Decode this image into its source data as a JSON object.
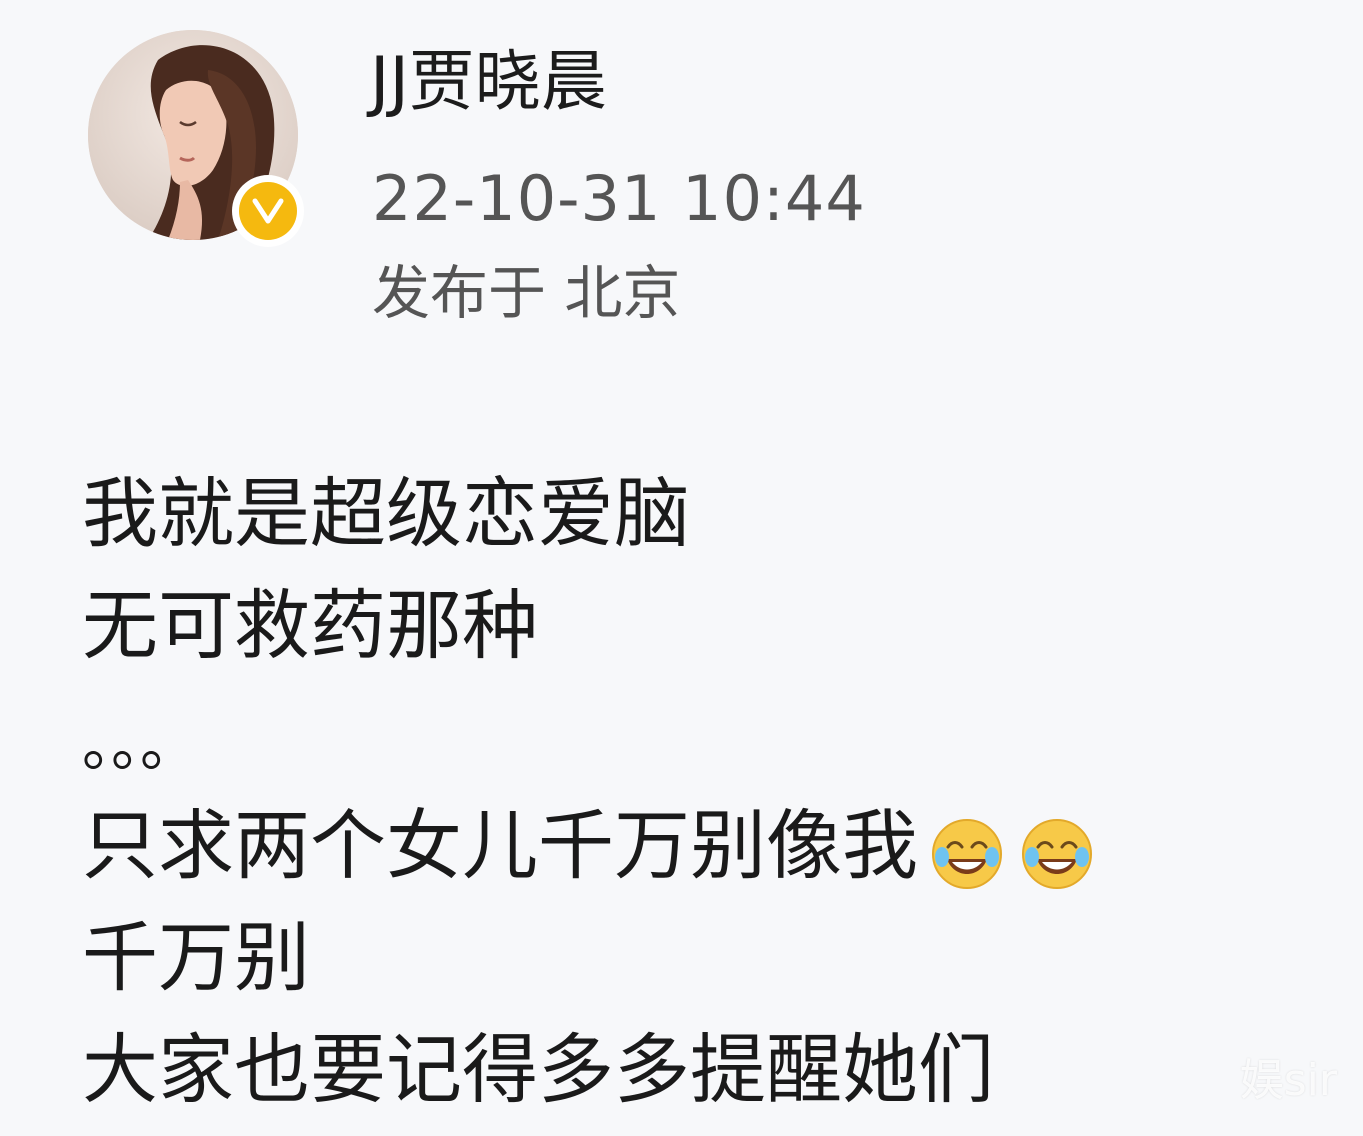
{
  "header": {
    "username": "JJ贾晓晨",
    "timestamp": "22-10-31 10:44",
    "location": "发布于 北京",
    "verified_badge_color": "#f5b90f"
  },
  "post": {
    "lines": [
      "我就是超级恋爱脑",
      "无可救药那种",
      "。。。",
      "只求两个女儿千万别像我",
      "千万别",
      "大家也要记得多多提醒她们"
    ],
    "emojis": [
      "laugh-cry-icon",
      "laugh-cry-icon"
    ]
  },
  "watermark": "娱sir"
}
